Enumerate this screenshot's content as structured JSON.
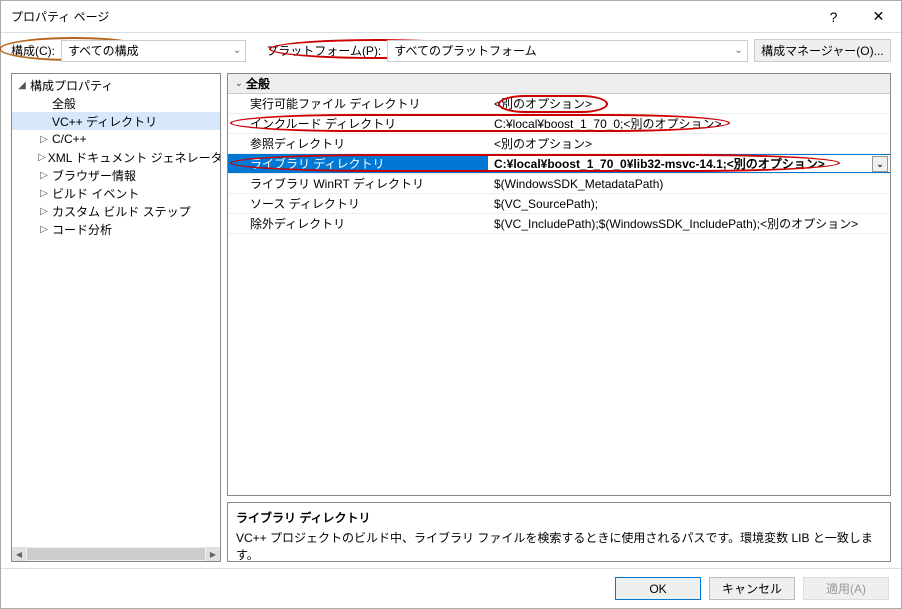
{
  "titlebar": {
    "title": "プロパティ ページ",
    "help": "?",
    "close": "✕"
  },
  "toolbar": {
    "config_label": "構成(C):",
    "config_value": "すべての構成",
    "platform_label": "プラットフォーム(P):",
    "platform_value": "すべてのプラットフォーム",
    "config_manager": "構成マネージャー(O)..."
  },
  "tree": {
    "root": "構成プロパティ",
    "items": [
      {
        "label": "全般",
        "indent": 1,
        "exp": ""
      },
      {
        "label": "VC++ ディレクトリ",
        "indent": 1,
        "exp": "",
        "selected": true
      },
      {
        "label": "C/C++",
        "indent": 1,
        "exp": "▷"
      },
      {
        "label": "XML ドキュメント ジェネレーター",
        "indent": 1,
        "exp": "▷"
      },
      {
        "label": "ブラウザー情報",
        "indent": 1,
        "exp": "▷"
      },
      {
        "label": "ビルド イベント",
        "indent": 1,
        "exp": "▷"
      },
      {
        "label": "カスタム ビルド ステップ",
        "indent": 1,
        "exp": "▷"
      },
      {
        "label": "コード分析",
        "indent": 1,
        "exp": "▷"
      }
    ]
  },
  "grid": {
    "section": "全般",
    "rows": [
      {
        "name": "実行可能ファイル ディレクトリ",
        "value": "<別のオプション>"
      },
      {
        "name": "インクルード ディレクトリ",
        "value": "C:¥local¥boost_1_70_0;<別のオプション>"
      },
      {
        "name": "参照ディレクトリ",
        "value": "<別のオプション>"
      },
      {
        "name": "ライブラリ ディレクトリ",
        "value": "C:¥local¥boost_1_70_0¥lib32-msvc-14.1;<別のオプション>",
        "selected": true
      },
      {
        "name": "ライブラリ WinRT ディレクトリ",
        "value": "$(WindowsSDK_MetadataPath)"
      },
      {
        "name": "ソース ディレクトリ",
        "value": "$(VC_SourcePath);"
      },
      {
        "name": "除外ディレクトリ",
        "value": "$(VC_IncludePath);$(WindowsSDK_IncludePath);<別のオプション>"
      }
    ]
  },
  "desc": {
    "title": "ライブラリ ディレクトリ",
    "text": "VC++ プロジェクトのビルド中、ライブラリ ファイルを検索するときに使用されるパスです。環境変数 LIB と一致します。"
  },
  "buttons": {
    "ok": "OK",
    "cancel": "キャンセル",
    "apply": "適用(A)"
  }
}
